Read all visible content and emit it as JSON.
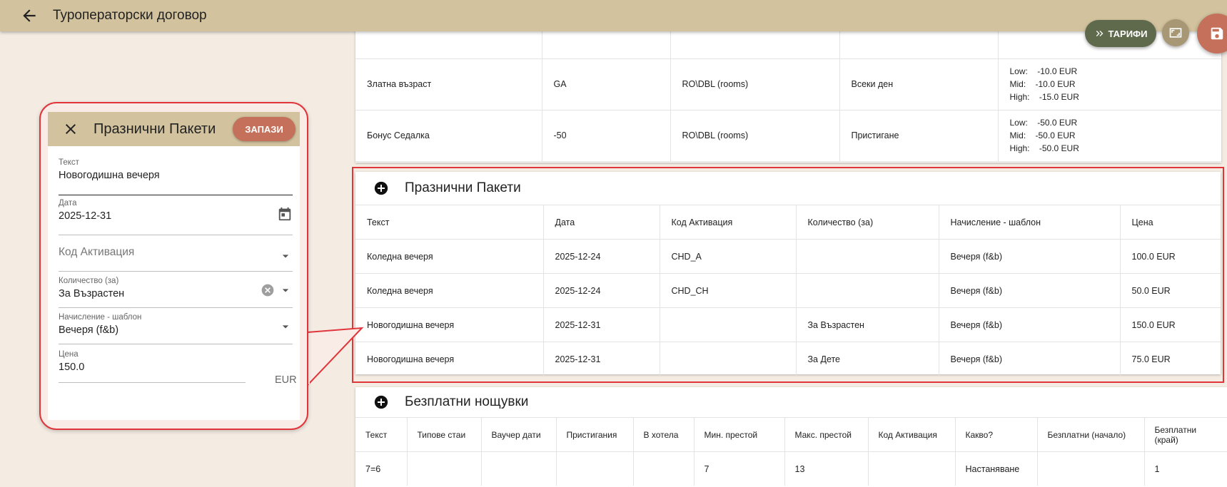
{
  "header": {
    "title": "Туроператорски договор"
  },
  "fabs": {
    "tariffs_label": "ТАРИФИ"
  },
  "top_table": {
    "rows": [
      {
        "text": "",
        "code": "",
        "room": "",
        "period": "",
        "prices": []
      },
      {
        "text": "Златна възраст",
        "code": "GA",
        "room": "RO\\DBL (rooms)",
        "period": "Всеки ден",
        "prices": [
          {
            "label": "Low:",
            "value": "-10.0 EUR"
          },
          {
            "label": "Mid:",
            "value": "-10.0 EUR"
          },
          {
            "label": "High:",
            "value": "-15.0 EUR"
          }
        ]
      },
      {
        "text": "Бонус Седалка",
        "code": "-50",
        "room": "RO\\DBL (rooms)",
        "period": "Пристигане",
        "prices": [
          {
            "label": "Low:",
            "value": "-50.0 EUR"
          },
          {
            "label": "Mid:",
            "value": "-50.0 EUR"
          },
          {
            "label": "High:",
            "value": "-50.0 EUR"
          }
        ]
      }
    ]
  },
  "holiday": {
    "title": "Празнични Пакети",
    "columns": [
      "Текст",
      "Дата",
      "Код Активация",
      "Количество (за)",
      "Начисление - шаблон",
      "Цена"
    ],
    "rows": [
      [
        "Коледна вечеря",
        "2025-12-24",
        "CHD_A",
        "",
        "Вечеря (f&b)",
        "100.0 EUR"
      ],
      [
        "Коледна вечеря",
        "2025-12-24",
        "CHD_CH",
        "",
        "Вечеря (f&b)",
        "50.0 EUR"
      ],
      [
        "Новогодишна вечеря",
        "2025-12-31",
        "",
        "За Възрастен",
        "Вечеря (f&b)",
        "150.0 EUR"
      ],
      [
        "Новогодишна вечеря",
        "2025-12-31",
        "",
        "За Дете",
        "Вечеря (f&b)",
        "75.0 EUR"
      ]
    ]
  },
  "free_nights": {
    "title": "Безплатни нощувки",
    "columns": [
      "Текст",
      "Типове стаи",
      "Ваучер дати",
      "Пристигания",
      "В хотела",
      "Мин. престой",
      "Макс. престой",
      "Код Активация",
      "Какво?",
      "Безплатни (начало)",
      "Безплатни (край)"
    ],
    "rows": [
      [
        "7=6",
        "",
        "",
        "",
        "",
        "7",
        "13",
        "",
        "Настаняване",
        "",
        "1"
      ]
    ]
  },
  "dialog": {
    "title": "Празнични Пакети",
    "save_label": "ЗАПАЗИ",
    "text_label": "Текст",
    "text_value": "Новогодишна вечеря",
    "date_label": "Дата",
    "date_value": "2025-12-31",
    "code_placeholder": "Код Активация",
    "qty_label": "Количество (за)",
    "qty_value": "За Възрастен",
    "template_label": "Начисление - шаблон",
    "template_value": "Вечеря (f&b)",
    "price_label": "Цена",
    "price_value": "150.0",
    "price_unit": "EUR"
  },
  "colors": {
    "accent_header": "#d2c29e",
    "save": "#c4705a",
    "tariffs": "#5f6a4d",
    "highlight": "#e0353b"
  }
}
